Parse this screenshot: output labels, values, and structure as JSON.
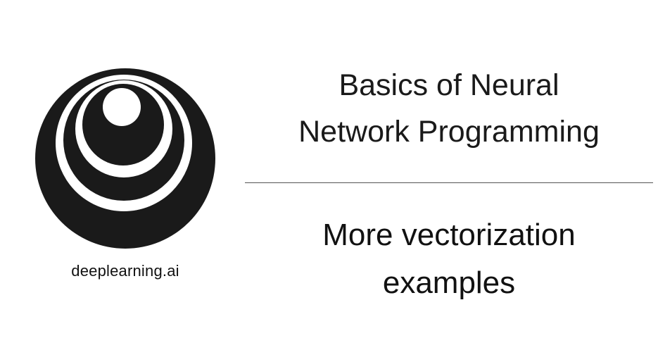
{
  "slide": {
    "brand": "deeplearning.ai",
    "title_line1": "Basics of Neural",
    "title_line2": "Network Programming",
    "subtitle_line1": "More vectorization",
    "subtitle_line2": "examples"
  },
  "colors": {
    "background": "#ffffff",
    "logo": "#1a1a1a",
    "text": "#111111",
    "divider": "#555555"
  },
  "icons": {
    "logo": "concentric-circles-logo"
  }
}
